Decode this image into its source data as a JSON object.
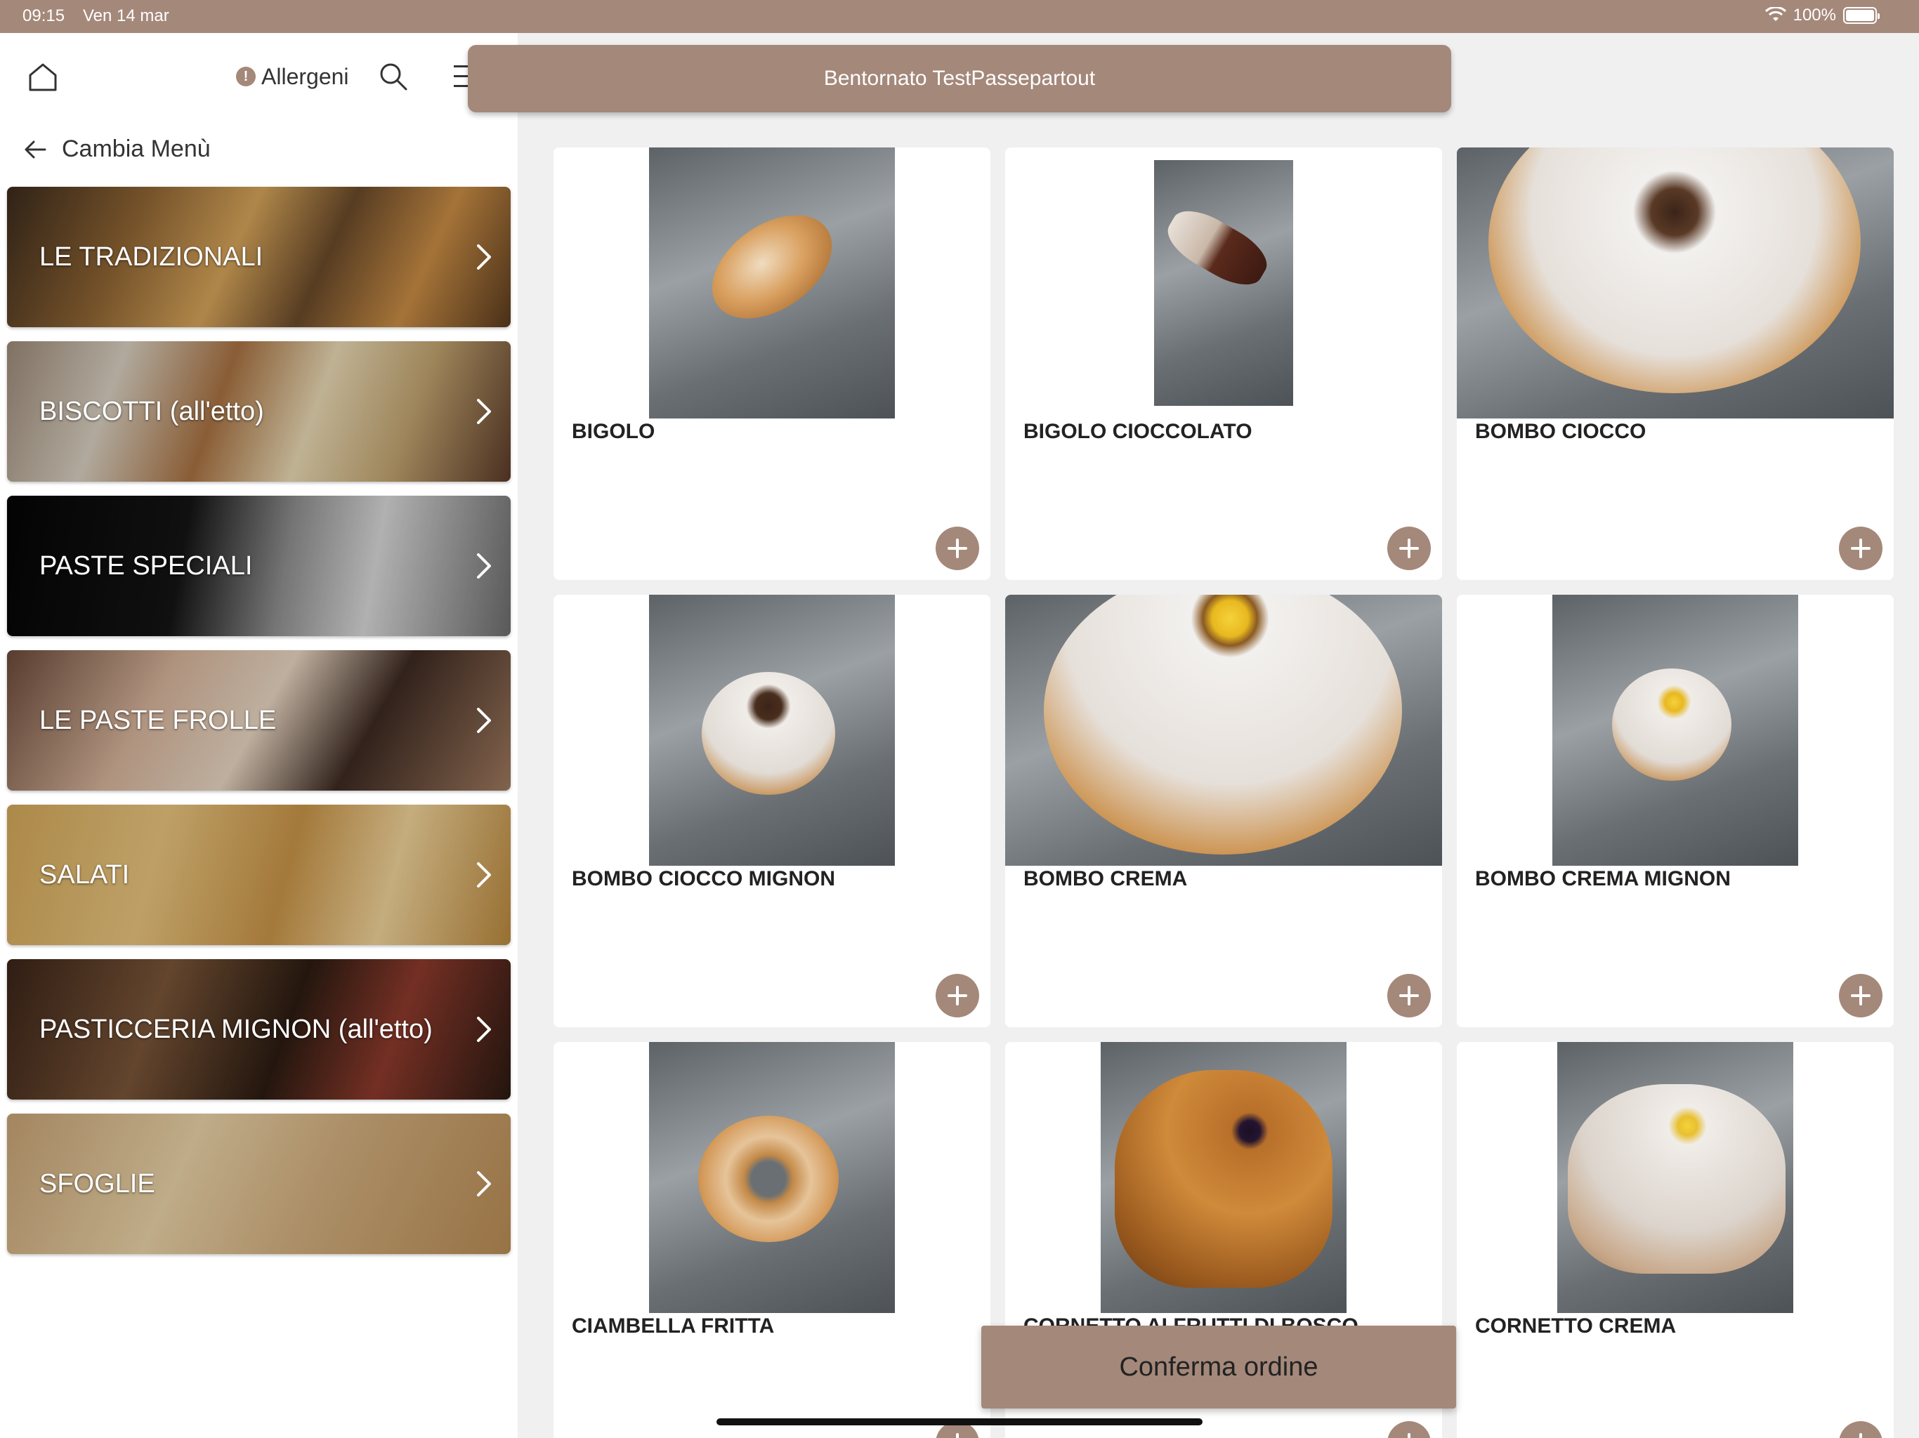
{
  "status_bar": {
    "time": "09:15",
    "date": "Ven 14 mar",
    "battery": "100%"
  },
  "sidebar": {
    "allergeni_label": "Allergeni",
    "back_label": "Cambia Menù",
    "categories": [
      {
        "label": "LE TRADIZIONALI"
      },
      {
        "label": "BISCOTTI (all'etto)"
      },
      {
        "label": "PASTE SPECIALI"
      },
      {
        "label": "LE PASTE FROLLE"
      },
      {
        "label": "SALATI"
      },
      {
        "label": "PASTICCERIA MIGNON (all'etto)"
      },
      {
        "label": "SFOGLIE"
      }
    ]
  },
  "header": {
    "welcome": "Bentornato TestPassepartout"
  },
  "products": [
    {
      "name": "BIGOLO"
    },
    {
      "name": "BIGOLO CIOCCOLATO"
    },
    {
      "name": "BOMBO CIOCCO"
    },
    {
      "name": "BOMBO CIOCCO MIGNON"
    },
    {
      "name": "BOMBO CREMA"
    },
    {
      "name": "BOMBO CREMA MIGNON"
    },
    {
      "name": "CIAMBELLA FRITTA"
    },
    {
      "name": "CORNETTO AI FRUTTI DI BOSCO"
    },
    {
      "name": "CORNETTO CREMA"
    }
  ],
  "footer": {
    "confirm_label": "Conferma ordine"
  },
  "colors": {
    "accent": "#a4887a"
  }
}
